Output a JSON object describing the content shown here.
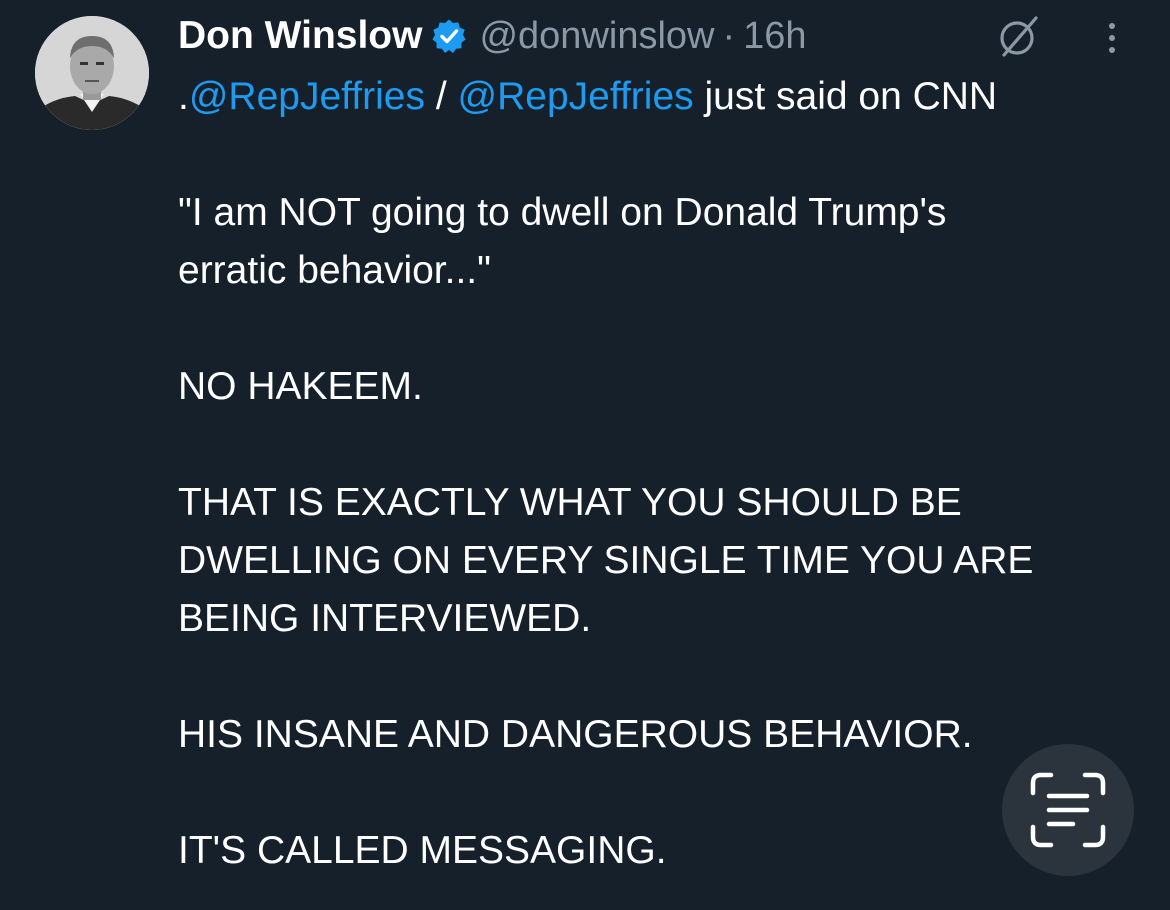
{
  "tweet": {
    "author_name": "Don Winslow",
    "handle": "@donwinslow",
    "separator": "·",
    "time": "16h",
    "prefix": ".",
    "mention_1": "@RepJeffries",
    "slash": " / ",
    "mention_2": "@RepJeffries",
    "after_mentions": " just said on CNN",
    "quote_line_1": "\"I am NOT going to dwell on Donald Trump's",
    "quote_line_2": "erratic behavior...\"",
    "line_no_hakeem": "NO HAKEEM.",
    "para_2_line_1": "THAT IS EXACTLY WHAT YOU SHOULD BE",
    "para_2_line_2": "DWELLING ON EVERY SINGLE TIME YOU ARE",
    "para_2_line_3": "BEING INTERVIEWED.",
    "para_3": "HIS INSANE AND DANGEROUS BEHAVIOR.",
    "para_4": "IT'S CALLED MESSAGING."
  },
  "icons": {
    "verified": "verified-badge-icon",
    "grok": "grok-icon",
    "more": "more-vertical-icon",
    "scan": "text-scan-icon"
  },
  "colors": {
    "background": "#15202b",
    "text": "#ffffff",
    "secondary": "#8b98a5",
    "link": "#1d9bf0",
    "verified": "#1d9bf0",
    "floating_button": "#2b343d"
  }
}
